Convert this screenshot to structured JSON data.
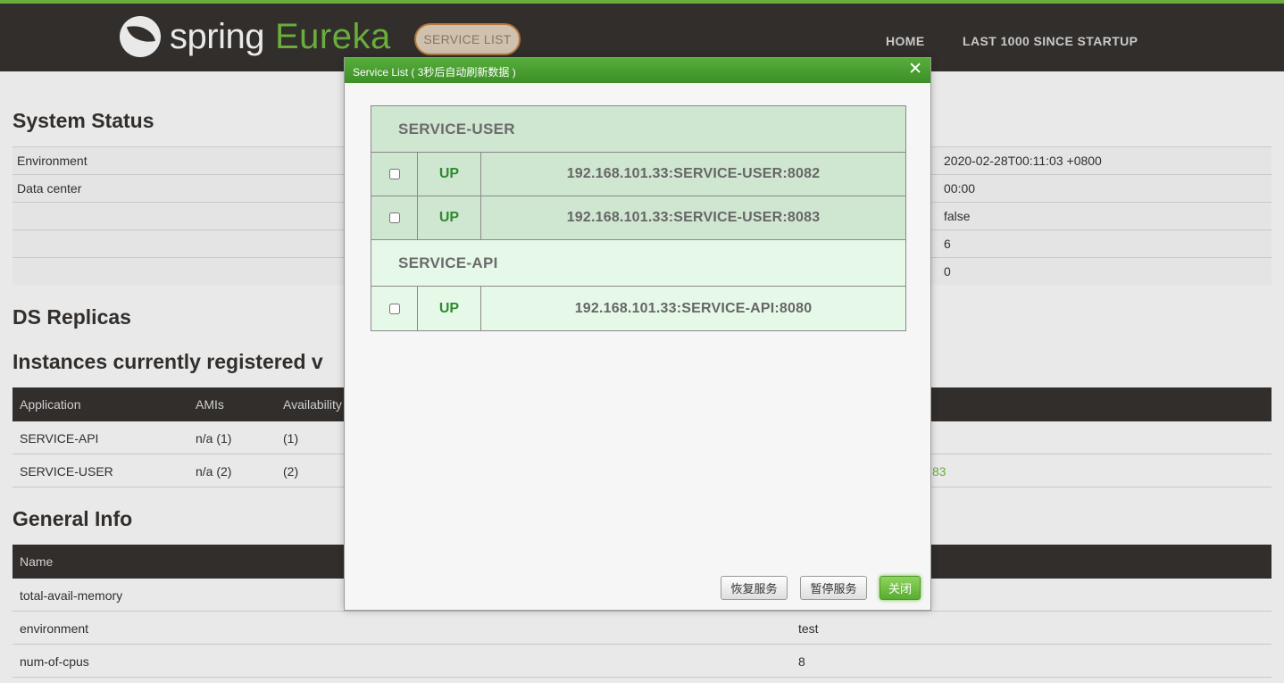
{
  "navbar": {
    "brand_spring": "spring",
    "brand_eureka": "Eureka",
    "service_list_button": "SERVICE LIST",
    "links": [
      "HOME",
      "LAST 1000 SINCE STARTUP"
    ]
  },
  "system_status": {
    "title": "System Status",
    "rows": [
      {
        "label": "Environment",
        "value": "2020-02-28T00:11:03 +0800"
      },
      {
        "label": "Data center",
        "value": "00:00"
      },
      {
        "label": "",
        "value": "false"
      },
      {
        "label": "",
        "value": "6"
      },
      {
        "label": "",
        "value": "0"
      }
    ]
  },
  "ds_replicas": {
    "title": "DS Replicas"
  },
  "instances": {
    "title": "Instances currently registered v",
    "headers": [
      "Application",
      "AMIs",
      "Availability"
    ],
    "rows": [
      {
        "app": "SERVICE-API",
        "amis": "n/a (1)",
        "avail": "(1)",
        "extra": ""
      },
      {
        "app": "SERVICE-USER",
        "amis": "n/a (2)",
        "avail": "(2)",
        "extra": "83"
      }
    ]
  },
  "general_info": {
    "title": "General Info",
    "header": "Name",
    "rows": [
      {
        "name": "total-avail-memory",
        "value": ""
      },
      {
        "name": "environment",
        "value": "test"
      },
      {
        "name": "num-of-cpus",
        "value": "8"
      }
    ]
  },
  "dialog": {
    "title": "Service List ( 3秒后自动刷新数据 )",
    "close_glyph": "✕",
    "groups": [
      {
        "name": "SERVICE-USER",
        "instances": [
          {
            "status": "UP",
            "id": "192.168.101.33:SERVICE-USER:8082"
          },
          {
            "status": "UP",
            "id": "192.168.101.33:SERVICE-USER:8083"
          }
        ]
      },
      {
        "name": "SERVICE-API",
        "instances": [
          {
            "status": "UP",
            "id": "192.168.101.33:SERVICE-API:8080"
          }
        ]
      }
    ],
    "buttons": {
      "restore": "恢复服务",
      "pause": "暂停服务",
      "close": "关闭"
    }
  },
  "colors": {
    "brand_green": "#6db33f",
    "nav_dark": "#34302d",
    "dialog_title_green": "#4a9e31",
    "status_up": "#2e8b2e"
  }
}
